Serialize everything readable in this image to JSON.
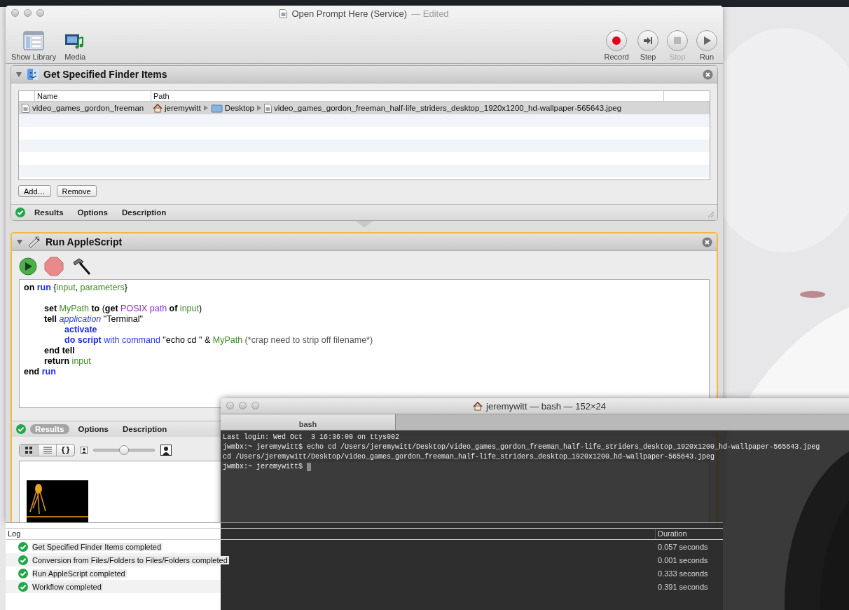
{
  "automator": {
    "title": "Open Prompt Here (Service)",
    "title_suffix": "— Edited",
    "toolbar_left": [
      {
        "kind": "library",
        "label": "Show Library"
      },
      {
        "kind": "media",
        "label": "Media"
      }
    ],
    "toolbar_right": [
      {
        "kind": "record",
        "label": "Record",
        "disabled": false
      },
      {
        "kind": "step",
        "label": "Step",
        "disabled": false
      },
      {
        "kind": "stop",
        "label": "Stop",
        "disabled": true
      },
      {
        "kind": "run",
        "label": "Run",
        "disabled": false
      }
    ],
    "actions": [
      {
        "kind": "finder_items",
        "title": "Get Specified Finder Items",
        "expanded": true,
        "selected": false,
        "table": {
          "columns": [
            "Name",
            "Path"
          ],
          "rows": [
            {
              "name": "video_games_gordon_freeman",
              "selected": true,
              "path": [
                {
                  "kind": "home",
                  "label": "jeremywitt"
                },
                {
                  "kind": "folder",
                  "label": "Desktop"
                },
                {
                  "kind": "file",
                  "label": "video_games_gordon_freeman_half-life_striders_desktop_1920x1200_hd-wallpaper-565643.jpeg"
                }
              ]
            }
          ]
        },
        "buttons": [
          "Add…",
          "Remove"
        ],
        "footer": {
          "done": true,
          "tabs": [
            {
              "label": "Results",
              "selected": false
            },
            {
              "label": "Options",
              "selected": false
            },
            {
              "label": "Description",
              "selected": false
            }
          ]
        }
      },
      {
        "kind": "applescript",
        "title": "Run AppleScript",
        "expanded": true,
        "selected": true,
        "code": [
          {
            "tokens": [
              {
                "kind": "keyword",
                "text": "on"
              },
              {
                "kind": "handler",
                "text": " run"
              },
              {
                "kind": "plain",
                "text": " {"
              },
              {
                "kind": "variable",
                "text": "input"
              },
              {
                "kind": "plain",
                "text": ", "
              },
              {
                "kind": "variable",
                "text": "parameters"
              },
              {
                "kind": "plain",
                "text": "}"
              }
            ],
            "children": [
              {
                "blank": true
              },
              {
                "tokens": [
                  {
                    "kind": "keyword",
                    "text": "set"
                  },
                  {
                    "kind": "variable",
                    "text": " MyPath"
                  },
                  {
                    "kind": "keyword",
                    "text": " to"
                  },
                  {
                    "kind": "plain",
                    "text": " ("
                  },
                  {
                    "kind": "keyword",
                    "text": "get"
                  },
                  {
                    "kind": "property",
                    "text": " POSIX path"
                  },
                  {
                    "kind": "keyword",
                    "text": " of"
                  },
                  {
                    "kind": "variable",
                    "text": " input"
                  },
                  {
                    "kind": "plain",
                    "text": ")"
                  }
                ]
              },
              {
                "tokens": [
                  {
                    "kind": "keyword",
                    "text": "tell"
                  },
                  {
                    "kind": "class",
                    "text": " application"
                  },
                  {
                    "kind": "plain",
                    "text": " \"Terminal\""
                  }
                ],
                "children": [
                  {
                    "tokens": [
                      {
                        "kind": "handler",
                        "text": "activate"
                      }
                    ]
                  },
                  {
                    "tokens": [
                      {
                        "kind": "handler",
                        "text": "do script"
                      },
                      {
                        "kind": "parameter",
                        "text": " with command"
                      },
                      {
                        "kind": "plain",
                        "text": " \"echo cd \" & "
                      },
                      {
                        "kind": "variable",
                        "text": "MyPath"
                      },
                      {
                        "kind": "comment",
                        "text": " (*crap need to strip off filename*)"
                      }
                    ]
                  }
                ]
              },
              {
                "tokens": [
                  {
                    "kind": "keyword",
                    "text": "end tell"
                  }
                ]
              },
              {
                "tokens": [
                  {
                    "kind": "keyword",
                    "text": "return"
                  },
                  {
                    "kind": "variable",
                    "text": " input"
                  }
                ]
              }
            ]
          },
          {
            "tokens": [
              {
                "kind": "keyword",
                "text": "end"
              },
              {
                "kind": "handler",
                "text": " run"
              }
            ]
          }
        ],
        "footer": {
          "done": true,
          "tabs": [
            {
              "label": "Results",
              "selected": true
            },
            {
              "label": "Options",
              "selected": false
            },
            {
              "label": "Description",
              "selected": false
            }
          ]
        },
        "results": {
          "views": [
            {
              "kind": "icons",
              "selected": true
            },
            {
              "kind": "list",
              "selected": false
            },
            {
              "kind": "code",
              "label": "{}",
              "selected": false
            }
          ],
          "zoom": {
            "level": 0.5
          }
        }
      }
    ],
    "log": {
      "columns": [
        "Log",
        "Duration"
      ],
      "entries": [
        {
          "text": "Get Specified Finder Items completed",
          "duration": "0.057 seconds",
          "done": true
        },
        {
          "text": "Conversion from Files/Folders to Files/Folders completed",
          "duration": "0.001 seconds",
          "done": true
        },
        {
          "text": "Run AppleScript completed",
          "duration": "0.333 seconds",
          "done": true
        },
        {
          "text": "Workflow completed",
          "duration": "0.391 seconds",
          "done": true
        }
      ]
    }
  },
  "terminal": {
    "title": "jeremywitt — bash — 152×24",
    "tabs": [
      {
        "label": "bash",
        "selected": true
      }
    ],
    "cursor": true,
    "lines": [
      "Last login: Wed Oct  3 16:36:00 on ttys002",
      "jwmbx:~ jeremywitt$ echo cd /Users/jeremywitt/Desktop/video_games_gordon_freeman_half-life_striders_desktop_1920x1200_hd-wallpaper-565643.jpeg",
      "cd /Users/jeremywitt/Desktop/video_games_gordon_freeman_half-life_striders_desktop_1920x1200_hd-wallpaper-565643.jpeg",
      "jwmbx:~ jeremywitt$ "
    ]
  }
}
